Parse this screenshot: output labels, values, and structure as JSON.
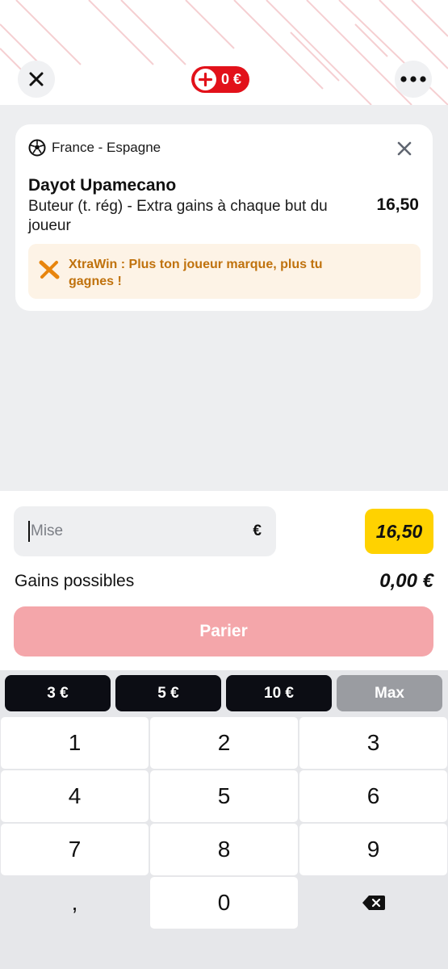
{
  "header": {
    "balance": "0 €",
    "icons": {
      "close": "close-icon",
      "add": "plus-icon",
      "more": "more-icon"
    }
  },
  "bet": {
    "match": "France - Espagne",
    "player": "Dayot Upamecano",
    "market": "Buteur (t. rég) - Extra gains à chaque but du joueur",
    "odds": "16,50",
    "promo": "XtraWin : Plus ton joueur marque, plus tu gagnes !"
  },
  "stake": {
    "placeholder": "Mise",
    "currency": "€",
    "odds_badge": "16,50",
    "gains_label": "Gains possibles",
    "gains_value": "0,00 €",
    "bet_button": "Parier"
  },
  "quick_stakes": [
    "3 €",
    "5 €",
    "10 €",
    "Max"
  ],
  "keypad": [
    "1",
    "2",
    "3",
    "4",
    "5",
    "6",
    "7",
    "8",
    "9",
    ",",
    "0"
  ],
  "colors": {
    "brand_red": "#e2111a",
    "bet_button_disabled": "#f4a6aa",
    "odds_yellow": "#ffd200",
    "promo_orange": "#c0720d",
    "promo_bg": "#fdf3e6"
  }
}
